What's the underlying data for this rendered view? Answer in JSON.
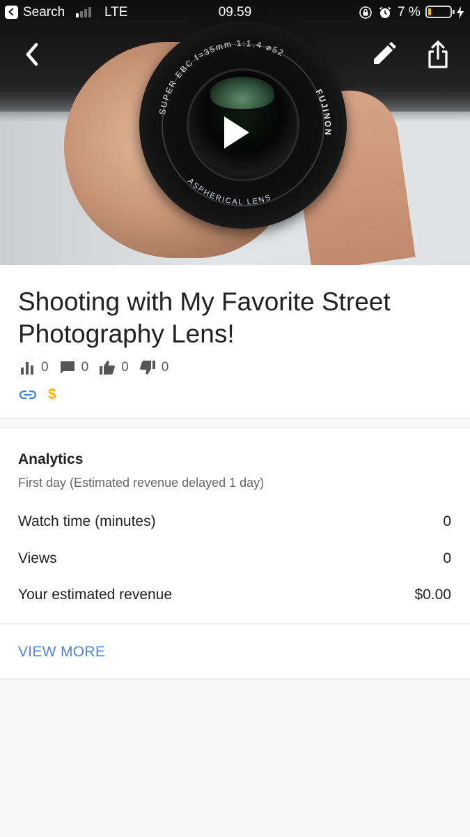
{
  "status_bar": {
    "back_app_label": "Search",
    "network": "LTE",
    "time": "09.59",
    "battery_percent": "7 %",
    "battery_level": 0.07,
    "signal_bars_filled": 1,
    "signal_bars_total": 4
  },
  "hero": {
    "lens_engraving_top": "SUPER EBC  f=35mm  1:1.4  ⌀52",
    "lens_engraving_right": "FUJINON",
    "lens_engraving_bottom": "ASPHERICAL LENS"
  },
  "video": {
    "title": "Shooting with My Favorite Street Photography Lens!",
    "stats": {
      "views": "0",
      "comments": "0",
      "likes": "0",
      "dislikes": "0"
    },
    "monetization_symbol": "$"
  },
  "analytics": {
    "heading": "Analytics",
    "subheading": "First day (Estimated revenue delayed 1 day)",
    "metrics": [
      {
        "label": "Watch time (minutes)",
        "value": "0"
      },
      {
        "label": "Views",
        "value": "0"
      },
      {
        "label": "Your estimated revenue",
        "value": "$0.00"
      }
    ],
    "view_more": "VIEW MORE"
  },
  "colors": {
    "accent_blue": "#4a86dc",
    "monetization_yellow": "#f4b400",
    "battery_low": "#f2c400"
  }
}
